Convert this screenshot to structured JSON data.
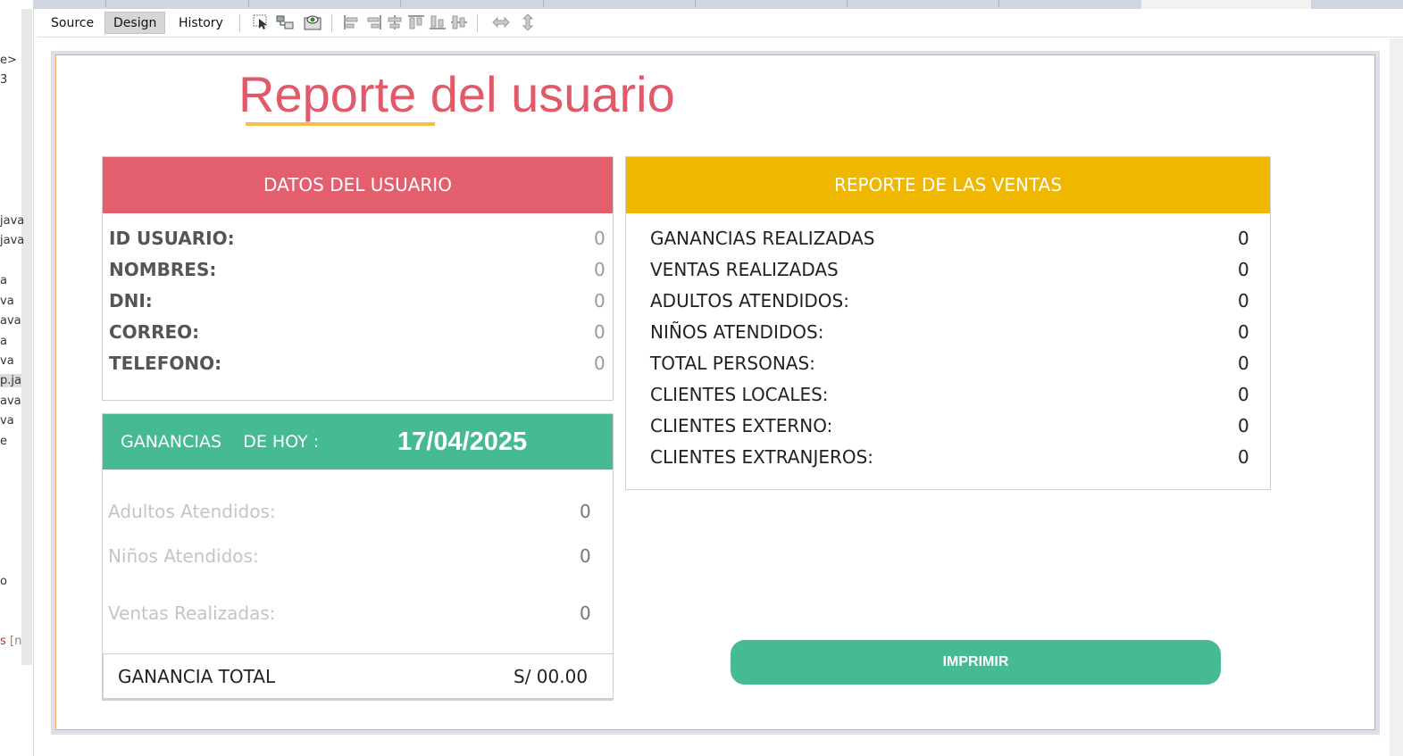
{
  "toolbar": {
    "source_label": "Source",
    "design_label": "Design",
    "history_label": "History"
  },
  "left_strip": {
    "fragments": [
      "e>",
      "3",
      "java",
      "java",
      "a",
      "va",
      "ava",
      "a",
      "va",
      "p.ja",
      "ava",
      "va",
      "e",
      "o",
      "s",
      "[n"
    ]
  },
  "title": "Reporte del usuario",
  "user_panel": {
    "header": "DATOS DEL USUARIO",
    "rows": [
      {
        "label": "ID USUARIO:",
        "value": "0"
      },
      {
        "label": "NOMBRES:",
        "value": "0"
      },
      {
        "label": "DNI:",
        "value": "0"
      },
      {
        "label": "CORREO:",
        "value": "0"
      },
      {
        "label": "TELEFONO:",
        "value": "0"
      }
    ]
  },
  "earnings_panel": {
    "header_label": "GANANCIAS    DE HOY :",
    "date": "17/04/2025",
    "rows": [
      {
        "label": "Adultos Atendidos:",
        "value": "0"
      },
      {
        "label": "Niños Atendidos:",
        "value": "0"
      },
      {
        "label": "Ventas Realizadas:",
        "value": "0"
      }
    ],
    "total_label": "GANANCIA TOTAL",
    "total_value": "S/ 00.00"
  },
  "sales_panel": {
    "header": "REPORTE DE LAS VENTAS",
    "rows": [
      {
        "label": "GANANCIAS REALIZADAS",
        "value": "0"
      },
      {
        "label": "VENTAS REALIZADAS",
        "value": "0"
      },
      {
        "label": "ADULTOS ATENDIDOS:",
        "value": "0"
      },
      {
        "label": "NIÑOS ATENDIDOS:",
        "value": "0"
      },
      {
        "label": "TOTAL PERSONAS:",
        "value": "0"
      },
      {
        "label": "CLIENTES LOCALES:",
        "value": "0"
      },
      {
        "label": "CLIENTES EXTERNO:",
        "value": "0"
      },
      {
        "label": "CLIENTES EXTRANJEROS:",
        "value": "0"
      }
    ]
  },
  "print_button": "IMPRIMIR",
  "colors": {
    "title": "#e05a6a",
    "user_header": "#e45f6d",
    "sales_header": "#efb700",
    "earnings_header": "#46b995",
    "print_button": "#46b995",
    "underline": "#f0c04a"
  },
  "icons": [
    "selection-mode-icon",
    "connection-mode-icon",
    "preview-design-icon",
    "align-left-icon",
    "align-right-icon",
    "center-horizontally-icon",
    "align-top-icon",
    "align-bottom-icon",
    "center-vertically-icon",
    "change-horizontal-resizability-icon",
    "change-vertical-resizability-icon"
  ]
}
